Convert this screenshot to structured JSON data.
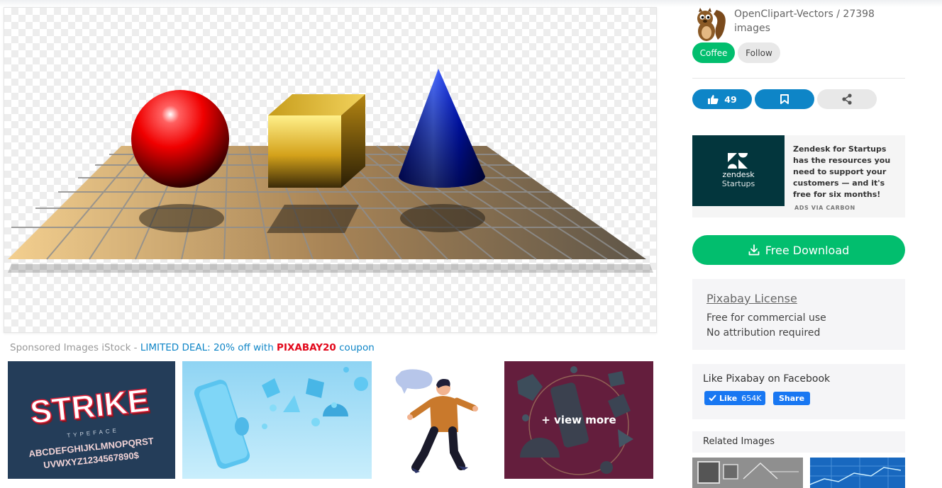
{
  "author": {
    "name": "OpenClipart-Vectors",
    "image_count_text": "/ 27398 images",
    "avatar_icon": "squirrel-avatar-icon"
  },
  "buttons": {
    "coffee": "Coffee",
    "follow": "Follow",
    "likes": "49",
    "download": "Free Download"
  },
  "icons": {
    "like": "thumbs-up-icon",
    "save": "bookmark-icon",
    "share": "share-icon",
    "download": "download-icon"
  },
  "ad": {
    "brand": "zendesk",
    "brand_sub": "Startups",
    "text": "Zendesk for Startups has the resources you need to support your customers — and it's free for six months!",
    "via": "ADS VIA CARBON"
  },
  "license": {
    "title": "Pixabay License",
    "line1": "Free for commercial use",
    "line2": "No attribution required"
  },
  "facebook": {
    "title": "Like Pixabay on Facebook",
    "like": "Like",
    "count": "654K",
    "share": "Share"
  },
  "sponsored": {
    "prefix": "Sponsored Images iStock - ",
    "deal": "LIMITED DEAL: 20% off with ",
    "code": "PIXABAY20",
    "suffix": " coupon"
  },
  "thumbs": {
    "strike_title": "STRIKE",
    "strike_sub": "TYPEFACE",
    "strike_alpha1": "ABCDEFGHIJKLMNOPQRST",
    "strike_alpha2": "UVWXYZ1234567890$",
    "view_more": "+ view more"
  },
  "related": {
    "title": "Related Images"
  },
  "colors": {
    "green": "#02be6e",
    "blue": "#0e85c7",
    "coupon_red": "#e2071a"
  }
}
